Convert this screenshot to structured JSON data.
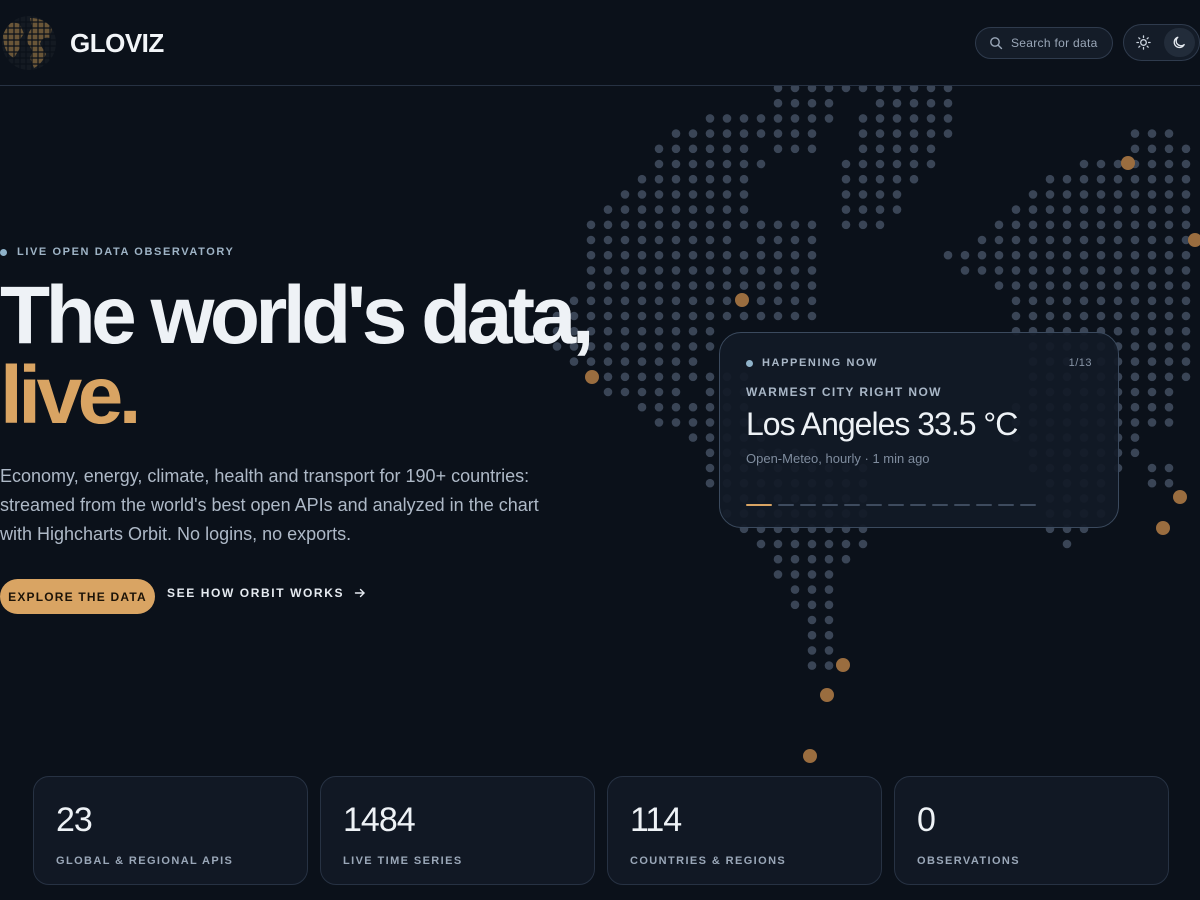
{
  "header": {
    "brand": "GLOVIZ",
    "search": {
      "placeholder": "Search for data"
    },
    "theme": {
      "light_icon": "sun-icon",
      "dark_icon": "moon-icon",
      "active": "dark"
    }
  },
  "hero": {
    "eyebrow": "LIVE OPEN DATA OBSERVATORY",
    "headline_line1": "The world's data,",
    "headline_line2": "live.",
    "lede": "Economy, energy, climate, health and transport for 190+ countries: streamed from the world's best open APIs and analyzed in the chart with Highcharts Orbit. No logins, no exports.",
    "primary_cta": "EXPLORE THE DATA",
    "secondary_cta": "SEE HOW ORBIT WORKS"
  },
  "happening": {
    "tag": "HAPPENING NOW",
    "counter": "1/13",
    "kicker": "WARMEST CITY RIGHT NOW",
    "headline": "Los Angeles 33.5 °C",
    "source": "Open-Meteo, hourly · 1 min ago",
    "slides_total": 13,
    "slide_active": 1
  },
  "stats": [
    {
      "value": "23",
      "label": "GLOBAL & REGIONAL APIS"
    },
    {
      "value": "1484",
      "label": "LIVE TIME SERIES"
    },
    {
      "value": "114",
      "label": "COUNTRIES & REGIONS"
    },
    {
      "value": "0",
      "label": "OBSERVATIONS"
    }
  ],
  "colors": {
    "background": "#0b111a",
    "accent": "#d9a463",
    "map_dot": "#3a4556",
    "highlight_dot": "#9a6d3f",
    "live_dot": "#8fb2c9"
  }
}
